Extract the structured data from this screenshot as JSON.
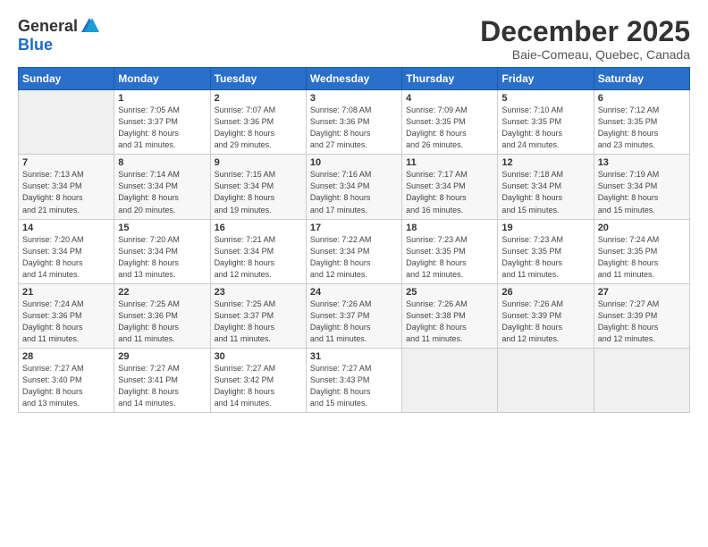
{
  "header": {
    "logo_general": "General",
    "logo_blue": "Blue",
    "title": "December 2025",
    "subtitle": "Baie-Comeau, Quebec, Canada"
  },
  "weekdays": [
    "Sunday",
    "Monday",
    "Tuesday",
    "Wednesday",
    "Thursday",
    "Friday",
    "Saturday"
  ],
  "weeks": [
    [
      {
        "num": "",
        "info": ""
      },
      {
        "num": "1",
        "info": "Sunrise: 7:05 AM\nSunset: 3:37 PM\nDaylight: 8 hours\nand 31 minutes."
      },
      {
        "num": "2",
        "info": "Sunrise: 7:07 AM\nSunset: 3:36 PM\nDaylight: 8 hours\nand 29 minutes."
      },
      {
        "num": "3",
        "info": "Sunrise: 7:08 AM\nSunset: 3:36 PM\nDaylight: 8 hours\nand 27 minutes."
      },
      {
        "num": "4",
        "info": "Sunrise: 7:09 AM\nSunset: 3:35 PM\nDaylight: 8 hours\nand 26 minutes."
      },
      {
        "num": "5",
        "info": "Sunrise: 7:10 AM\nSunset: 3:35 PM\nDaylight: 8 hours\nand 24 minutes."
      },
      {
        "num": "6",
        "info": "Sunrise: 7:12 AM\nSunset: 3:35 PM\nDaylight: 8 hours\nand 23 minutes."
      }
    ],
    [
      {
        "num": "7",
        "info": "Sunrise: 7:13 AM\nSunset: 3:34 PM\nDaylight: 8 hours\nand 21 minutes."
      },
      {
        "num": "8",
        "info": "Sunrise: 7:14 AM\nSunset: 3:34 PM\nDaylight: 8 hours\nand 20 minutes."
      },
      {
        "num": "9",
        "info": "Sunrise: 7:15 AM\nSunset: 3:34 PM\nDaylight: 8 hours\nand 19 minutes."
      },
      {
        "num": "10",
        "info": "Sunrise: 7:16 AM\nSunset: 3:34 PM\nDaylight: 8 hours\nand 17 minutes."
      },
      {
        "num": "11",
        "info": "Sunrise: 7:17 AM\nSunset: 3:34 PM\nDaylight: 8 hours\nand 16 minutes."
      },
      {
        "num": "12",
        "info": "Sunrise: 7:18 AM\nSunset: 3:34 PM\nDaylight: 8 hours\nand 15 minutes."
      },
      {
        "num": "13",
        "info": "Sunrise: 7:19 AM\nSunset: 3:34 PM\nDaylight: 8 hours\nand 15 minutes."
      }
    ],
    [
      {
        "num": "14",
        "info": "Sunrise: 7:20 AM\nSunset: 3:34 PM\nDaylight: 8 hours\nand 14 minutes."
      },
      {
        "num": "15",
        "info": "Sunrise: 7:20 AM\nSunset: 3:34 PM\nDaylight: 8 hours\nand 13 minutes."
      },
      {
        "num": "16",
        "info": "Sunrise: 7:21 AM\nSunset: 3:34 PM\nDaylight: 8 hours\nand 12 minutes."
      },
      {
        "num": "17",
        "info": "Sunrise: 7:22 AM\nSunset: 3:34 PM\nDaylight: 8 hours\nand 12 minutes."
      },
      {
        "num": "18",
        "info": "Sunrise: 7:23 AM\nSunset: 3:35 PM\nDaylight: 8 hours\nand 12 minutes."
      },
      {
        "num": "19",
        "info": "Sunrise: 7:23 AM\nSunset: 3:35 PM\nDaylight: 8 hours\nand 11 minutes."
      },
      {
        "num": "20",
        "info": "Sunrise: 7:24 AM\nSunset: 3:35 PM\nDaylight: 8 hours\nand 11 minutes."
      }
    ],
    [
      {
        "num": "21",
        "info": "Sunrise: 7:24 AM\nSunset: 3:36 PM\nDaylight: 8 hours\nand 11 minutes."
      },
      {
        "num": "22",
        "info": "Sunrise: 7:25 AM\nSunset: 3:36 PM\nDaylight: 8 hours\nand 11 minutes."
      },
      {
        "num": "23",
        "info": "Sunrise: 7:25 AM\nSunset: 3:37 PM\nDaylight: 8 hours\nand 11 minutes."
      },
      {
        "num": "24",
        "info": "Sunrise: 7:26 AM\nSunset: 3:37 PM\nDaylight: 8 hours\nand 11 minutes."
      },
      {
        "num": "25",
        "info": "Sunrise: 7:26 AM\nSunset: 3:38 PM\nDaylight: 8 hours\nand 11 minutes."
      },
      {
        "num": "26",
        "info": "Sunrise: 7:26 AM\nSunset: 3:39 PM\nDaylight: 8 hours\nand 12 minutes."
      },
      {
        "num": "27",
        "info": "Sunrise: 7:27 AM\nSunset: 3:39 PM\nDaylight: 8 hours\nand 12 minutes."
      }
    ],
    [
      {
        "num": "28",
        "info": "Sunrise: 7:27 AM\nSunset: 3:40 PM\nDaylight: 8 hours\nand 13 minutes."
      },
      {
        "num": "29",
        "info": "Sunrise: 7:27 AM\nSunset: 3:41 PM\nDaylight: 8 hours\nand 14 minutes."
      },
      {
        "num": "30",
        "info": "Sunrise: 7:27 AM\nSunset: 3:42 PM\nDaylight: 8 hours\nand 14 minutes."
      },
      {
        "num": "31",
        "info": "Sunrise: 7:27 AM\nSunset: 3:43 PM\nDaylight: 8 hours\nand 15 minutes."
      },
      {
        "num": "",
        "info": ""
      },
      {
        "num": "",
        "info": ""
      },
      {
        "num": "",
        "info": ""
      }
    ]
  ]
}
